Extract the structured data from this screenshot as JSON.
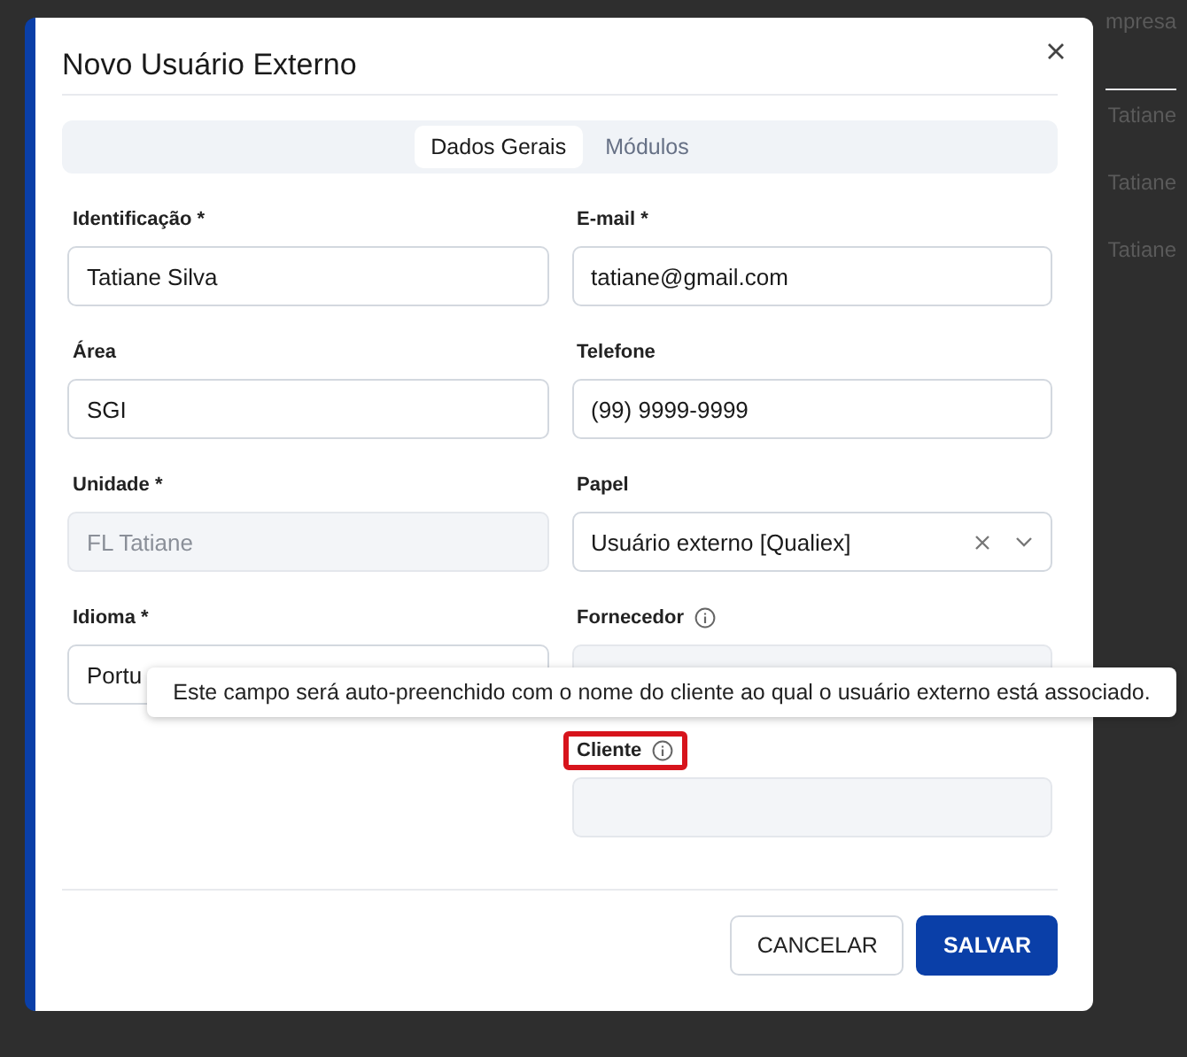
{
  "background_table": {
    "header": "mpresa",
    "cells": [
      "Tatiane",
      "Tatiane",
      "Tatiane"
    ]
  },
  "dialog": {
    "title": "Novo Usuário Externo",
    "tabs": [
      {
        "label": "Dados Gerais",
        "selected": true
      },
      {
        "label": "Módulos",
        "selected": false
      }
    ],
    "columns": [
      [
        {
          "label": "Identificação *",
          "kind": "text",
          "value": "Tatiane Silva",
          "disabled": false
        },
        {
          "label": "Área",
          "kind": "text",
          "value": "SGI",
          "disabled": false
        },
        {
          "label": "Unidade *",
          "kind": "text",
          "value": "FL Tatiane",
          "disabled": true
        },
        {
          "label": "Idioma *",
          "kind": "text",
          "value": "Portu",
          "disabled": false
        }
      ],
      [
        {
          "label": "E-mail *",
          "kind": "text",
          "value": "tatiane@gmail.com",
          "disabled": false
        },
        {
          "label": "Telefone",
          "kind": "text",
          "value": "(99) 9999-9999",
          "disabled": false
        },
        {
          "label": "Papel",
          "kind": "select",
          "value": "Usuário externo [Qualiex]",
          "disabled": false
        },
        {
          "label": "Fornecedor",
          "kind": "text",
          "info": true,
          "disabled": true
        },
        {
          "label": "Cliente",
          "kind": "text",
          "info": true,
          "highlight": true,
          "disabled": true
        }
      ]
    ],
    "tooltip": "Este campo será auto-preenchido com o nome do cliente ao qual o usuário externo está associado.",
    "buttons": [
      {
        "label": "CANCELAR",
        "kind": "secondary"
      },
      {
        "label": "SALVAR",
        "kind": "primary"
      }
    ]
  }
}
